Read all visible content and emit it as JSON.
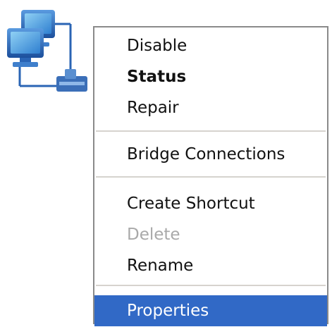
{
  "desktop": {
    "icon": "network-connection-icon"
  },
  "context_menu": {
    "items": [
      {
        "label": "Disable"
      },
      {
        "label": "Status"
      },
      {
        "label": "Repair"
      },
      {
        "label": "Bridge Connections"
      },
      {
        "label": "Create Shortcut"
      },
      {
        "label": "Delete"
      },
      {
        "label": "Rename"
      },
      {
        "label": "Properties"
      }
    ],
    "default_item": "Status",
    "disabled_items": [
      "Delete"
    ],
    "highlighted_item": "Properties",
    "highlight_color": "#3169c6"
  }
}
